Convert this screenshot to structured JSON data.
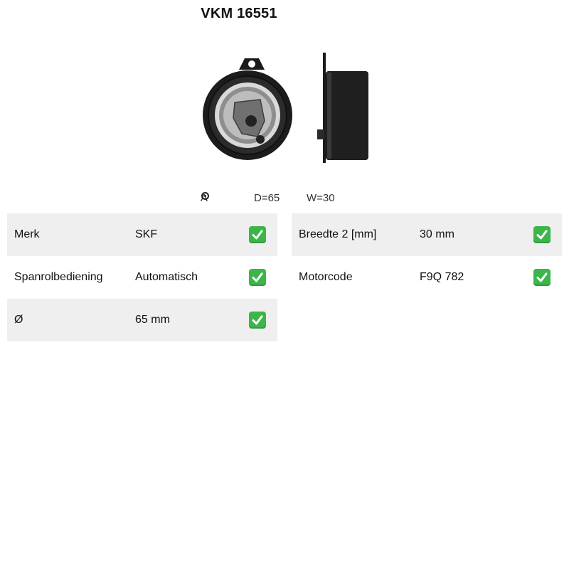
{
  "product": {
    "title": "VKM 16551",
    "image_icon": "tensioner-pulley-icon"
  },
  "spec_strip": {
    "a_label": "A",
    "a_icon": "bearing-icon",
    "d_label": "D=65",
    "w_label": "W=30"
  },
  "colors": {
    "row_shade": "#efefef",
    "check": "#3cb54a"
  },
  "left_table": {
    "rows": [
      {
        "label": "Merk",
        "value": "SKF",
        "icon": "check-icon"
      },
      {
        "label": "Spanrolbediening",
        "value": "Automatisch",
        "icon": "check-icon"
      },
      {
        "label": "Ø",
        "value": "65 mm",
        "icon": "check-icon"
      }
    ]
  },
  "right_table": {
    "rows": [
      {
        "label": "Breedte 2 [mm]",
        "value": "30 mm",
        "icon": "check-icon"
      },
      {
        "label": "Motorcode",
        "value": "F9Q 782",
        "icon": "check-icon"
      }
    ]
  }
}
